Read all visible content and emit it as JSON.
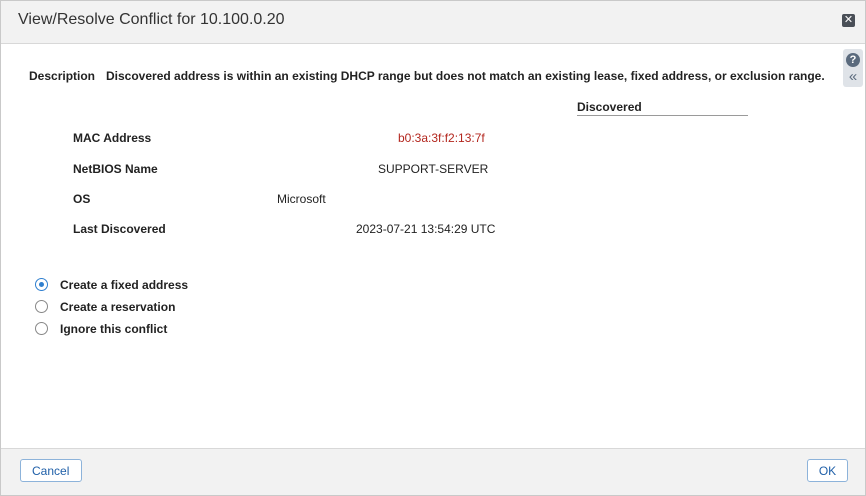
{
  "dialog": {
    "title": "View/Resolve Conflict for 10.100.0.20",
    "close_icon": "close-icon",
    "help_icon": "help-icon",
    "collapse_icon": "double-chevron-left-icon"
  },
  "description": {
    "label": "Description",
    "text": "Discovered address is within an existing DHCP range but does not match an existing lease, fixed address, or exclusion range."
  },
  "table": {
    "column_header": "Discovered",
    "rows": [
      {
        "label": "MAC Address",
        "value": "b0:3a:3f:f2:13:7f"
      },
      {
        "label": "NetBIOS Name",
        "value": "SUPPORT-SERVER"
      },
      {
        "label": "OS",
        "value": "Microsoft"
      },
      {
        "label": "Last Discovered",
        "value": "2023-07-21 13:54:29 UTC"
      }
    ]
  },
  "options": [
    {
      "label": "Create a fixed address",
      "selected": true
    },
    {
      "label": "Create a reservation",
      "selected": false
    },
    {
      "label": "Ignore this conflict",
      "selected": false
    }
  ],
  "footer": {
    "cancel_label": "Cancel",
    "ok_label": "OK"
  },
  "colors": {
    "accent": "#2f7fcf",
    "mac_value": "#b3261e",
    "button_text": "#1f5fa8"
  }
}
